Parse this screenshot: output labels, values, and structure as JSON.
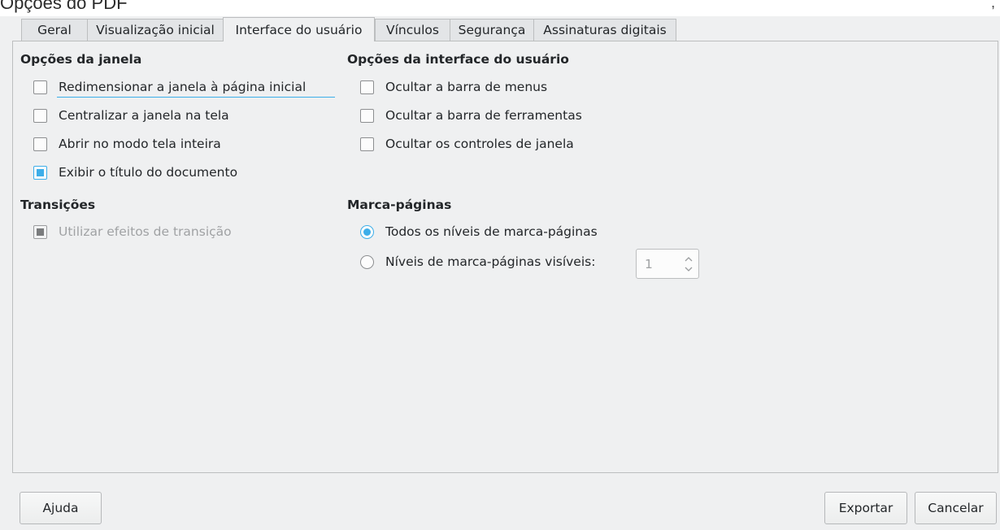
{
  "window": {
    "title": "Opções do PDF",
    "corner_mark": ","
  },
  "tabs": [
    {
      "label": "Geral"
    },
    {
      "label": "Visualização inicial"
    },
    {
      "label": "Interface do usuário"
    },
    {
      "label": "Vínculos"
    },
    {
      "label": "Segurança"
    },
    {
      "label": "Assinaturas digitais"
    }
  ],
  "active_tab": "Interface do usuário",
  "window_options": {
    "title": "Opções da janela",
    "items": [
      {
        "label": "Redimensionar a janela à página inicial",
        "checked": false
      },
      {
        "label": "Centralizar a janela na tela",
        "checked": false
      },
      {
        "label": "Abrir no modo tela inteira",
        "checked": false
      },
      {
        "label": "Exibir o título do documento",
        "checked": true
      }
    ]
  },
  "ui_options": {
    "title": "Opções da interface do usuário",
    "items": [
      {
        "label": "Ocultar a barra de menus",
        "checked": false
      },
      {
        "label": "Ocultar a barra de ferramentas",
        "checked": false
      },
      {
        "label": "Ocultar os controles de janela",
        "checked": false
      }
    ]
  },
  "transitions": {
    "title": "Transições",
    "items": [
      {
        "label": "Utilizar efeitos de transição",
        "checked": true,
        "enabled": false
      }
    ]
  },
  "bookmarks": {
    "title": "Marca-páginas",
    "items": [
      {
        "label": "Todos os níveis de marca-páginas",
        "selected": true
      },
      {
        "label": "Níveis de marca-páginas visíveis:",
        "selected": false
      }
    ],
    "levels_value": "1"
  },
  "buttons": {
    "help": "Ajuda",
    "export": "Exportar",
    "cancel": "Cancelar"
  },
  "colors": {
    "accent": "#3daee9",
    "dialog_bg": "#eff0f1",
    "border": "#bcbebf"
  }
}
